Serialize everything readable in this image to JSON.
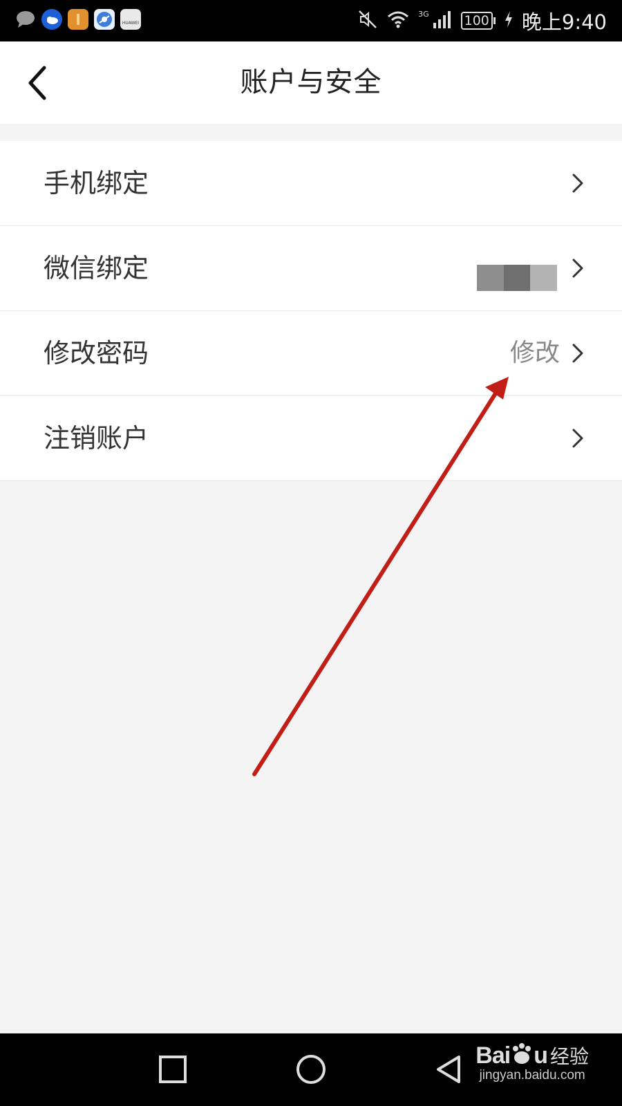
{
  "status_bar": {
    "time": "晚上9:40",
    "battery": "100",
    "network": "3G",
    "app_icons": [
      "message-icon",
      "weather-icon",
      "gift-icon",
      "browser-icon",
      "huawei-store-icon"
    ],
    "huawei_text": "HUAWEI"
  },
  "nav": {
    "title": "账户与安全",
    "back_icon": "chevron-left-icon"
  },
  "items": [
    {
      "label": "手机绑定",
      "value": ""
    },
    {
      "label": "微信绑定",
      "value": ""
    },
    {
      "label": "修改密码",
      "value": "修改"
    },
    {
      "label": "注销账户",
      "value": ""
    }
  ],
  "watermark": {
    "logo": "Bai",
    "logo_end": "u",
    "cn": "经验",
    "url": "jingyan.baidu.com"
  },
  "colors": {
    "background": "#f4f4f4",
    "arrow": "#c01e17"
  }
}
